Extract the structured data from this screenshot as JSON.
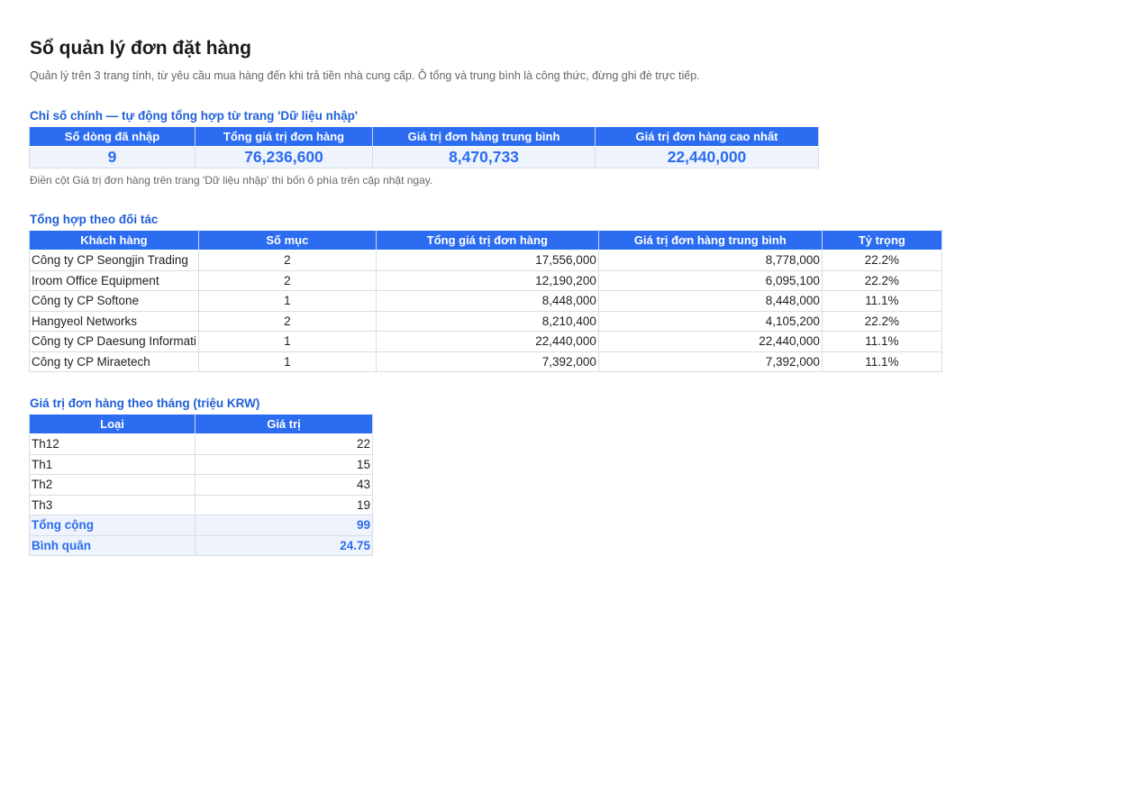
{
  "header": {
    "title": "Sổ quản lý đơn đặt hàng",
    "subtitle": "Quản lý trên 3 trang tính, từ yêu cầu mua hàng đến khi trả tiền nhà cung cấp. Ô tổng và trung bình là công thức, đừng ghi đè trực tiếp."
  },
  "kpi": {
    "title": "Chỉ số chính — tự động tổng hợp từ trang 'Dữ liệu nhập'",
    "headers": [
      "Số dòng đã nhập",
      "Tổng giá trị đơn hàng",
      "Giá trị đơn hàng trung bình",
      "Giá trị đơn hàng cao nhất"
    ],
    "values": [
      "9",
      "76,236,600",
      "8,470,733",
      "22,440,000"
    ],
    "note": "Điền cột Giá trị đơn hàng trên trang 'Dữ liệu nhập' thì bốn ô phía trên cập nhật ngay."
  },
  "partners": {
    "title": "Tổng hợp theo đối tác",
    "headers": [
      "Khách hàng",
      "Số mục",
      "Tổng giá trị đơn hàng",
      "Giá trị đơn hàng trung bình",
      "Tỷ trọng"
    ],
    "rows": [
      [
        "Công ty CP Seongjin Trading",
        "2",
        "17,556,000",
        "8,778,000",
        "22.2%"
      ],
      [
        "Iroom Office Equipment",
        "2",
        "12,190,200",
        "6,095,100",
        "22.2%"
      ],
      [
        "Công ty CP Softone",
        "1",
        "8,448,000",
        "8,448,000",
        "11.1%"
      ],
      [
        "Hangyeol Networks",
        "2",
        "8,210,400",
        "4,105,200",
        "22.2%"
      ],
      [
        "Công ty CP Daesung Informati",
        "1",
        "22,440,000",
        "22,440,000",
        "11.1%"
      ],
      [
        "Công ty CP Miraetech",
        "1",
        "7,392,000",
        "7,392,000",
        "11.1%"
      ]
    ]
  },
  "monthly": {
    "title": "Giá trị đơn hàng theo tháng (triệu KRW)",
    "headers": [
      "Loại",
      "Giá trị"
    ],
    "rows": [
      [
        "Th12",
        "22"
      ],
      [
        "Th1",
        "15"
      ],
      [
        "Th2",
        "43"
      ],
      [
        "Th3",
        "19"
      ]
    ],
    "totals": [
      [
        "Tổng cộng",
        "99"
      ],
      [
        "Bình quân",
        "24.75"
      ]
    ]
  },
  "colors": {
    "accent": "#2b6cf0",
    "accent_text": "#1f5fd9",
    "highlight_fill": "#eef3fc",
    "grid_line": "#d7dde8"
  }
}
